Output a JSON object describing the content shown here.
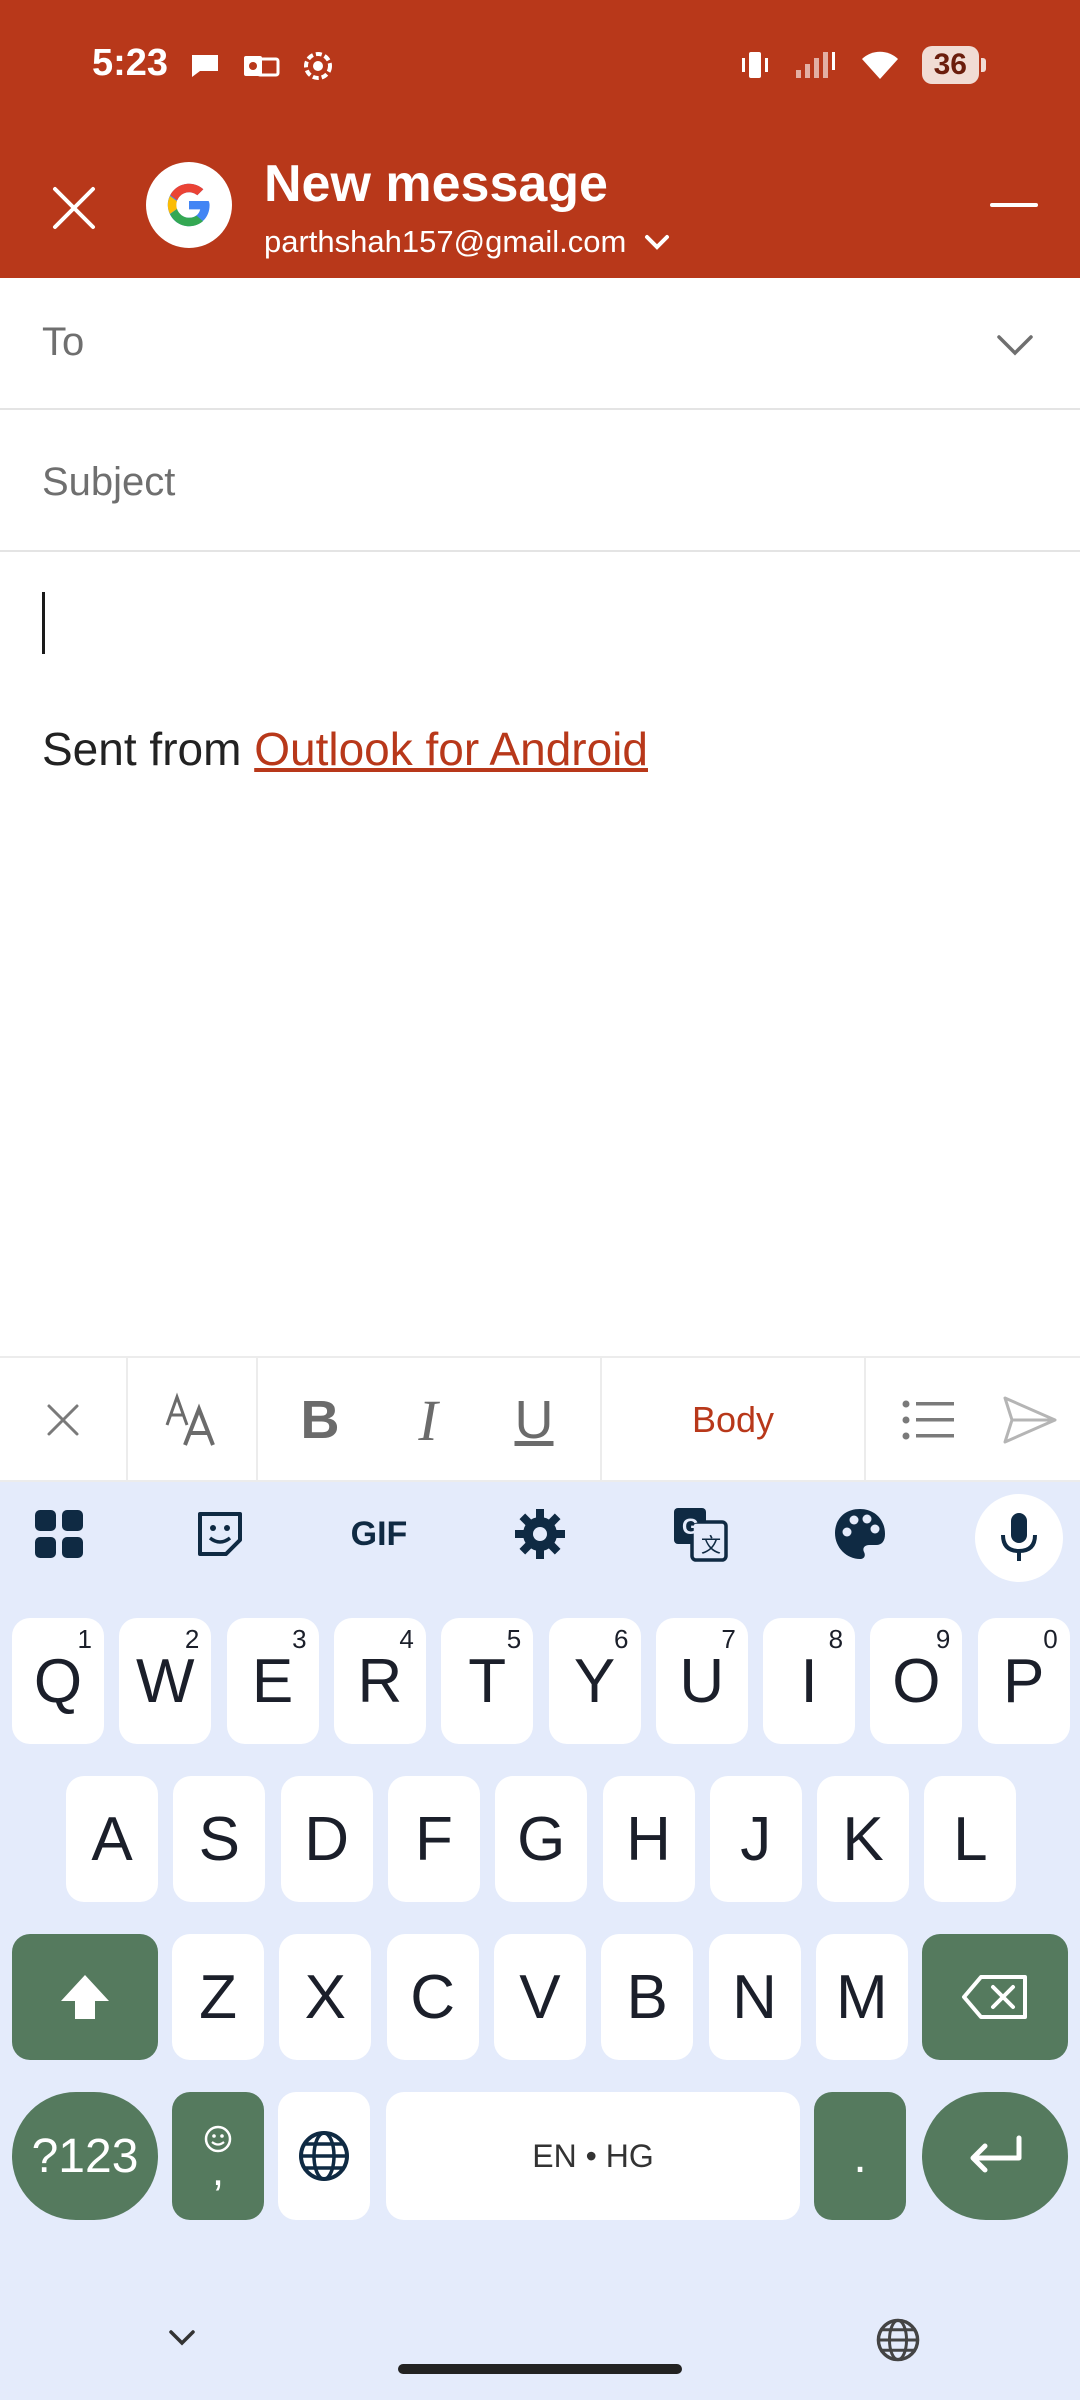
{
  "status_bar": {
    "time": "5:23",
    "battery": "36"
  },
  "header": {
    "title": "New message",
    "account": "parthshah157@gmail.com",
    "accent_color": "#B8381A"
  },
  "fields": {
    "to_label": "To",
    "subject_label": "Subject"
  },
  "body": {
    "signature_prefix": "Sent from ",
    "signature_link": "Outlook for Android"
  },
  "format_toolbar": {
    "font_size_icon": "text-size-icon",
    "bold": "B",
    "italic": "I",
    "underline": "U",
    "paragraph_style": "Body"
  },
  "keyboard": {
    "toolbar": [
      "apps-grid-icon",
      "sticker-icon",
      "gif-icon",
      "settings-icon",
      "translate-icon",
      "palette-icon",
      "mic-icon"
    ],
    "gif_label": "GIF",
    "row1": [
      {
        "key": "Q",
        "hint": "1"
      },
      {
        "key": "W",
        "hint": "2"
      },
      {
        "key": "E",
        "hint": "3"
      },
      {
        "key": "R",
        "hint": "4"
      },
      {
        "key": "T",
        "hint": "5"
      },
      {
        "key": "Y",
        "hint": "6"
      },
      {
        "key": "U",
        "hint": "7"
      },
      {
        "key": "I",
        "hint": "8"
      },
      {
        "key": "O",
        "hint": "9"
      },
      {
        "key": "P",
        "hint": "0"
      }
    ],
    "row2": [
      "A",
      "S",
      "D",
      "F",
      "G",
      "H",
      "J",
      "K",
      "L"
    ],
    "row3": [
      "Z",
      "X",
      "C",
      "V",
      "B",
      "N",
      "M"
    ],
    "symbols_label": "?123",
    "comma_label": ",",
    "space_label": "EN • HG",
    "period_label": ".",
    "key_color": "#557A5E",
    "background_color": "#E4EBFB"
  }
}
